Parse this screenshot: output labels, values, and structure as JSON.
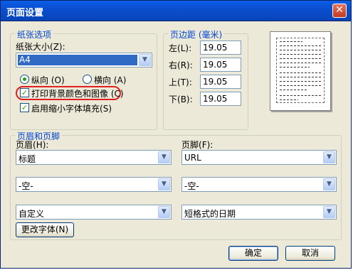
{
  "window": {
    "title": "页面设置",
    "close_label": "✕"
  },
  "paper": {
    "legend": "纸张选项",
    "size_label": "纸张大小",
    "size_key": "(Z)",
    "size_value": "A4",
    "orientation": {
      "portrait_label": "纵向",
      "portrait_key": "(O)",
      "landscape_label": "横向",
      "landscape_key": "(A)",
      "selected": "portrait"
    },
    "print_background_label": "打印背景颜色和图像",
    "print_background_key": "(C)",
    "print_background_checked": true,
    "shrink_to_fit_label": "启用缩小字体填充",
    "shrink_to_fit_key": "(S)",
    "shrink_to_fit_checked": true
  },
  "margins": {
    "legend": "页边距 (毫米)",
    "left_label": "左",
    "left_key": "(L)",
    "left_value": "19.05",
    "right_label": "右",
    "right_key": "(R)",
    "right_value": "19.05",
    "top_label": "上",
    "top_key": "(T)",
    "top_value": "19.05",
    "bottom_label": "下",
    "bottom_key": "(B)",
    "bottom_value": "19.05"
  },
  "headers_footers": {
    "legend": "页眉和页脚",
    "header_label": "页眉",
    "header_key": "(H)",
    "footer_label": "页脚",
    "footer_key": "(F)",
    "header_rows": [
      "标题",
      "-空-",
      "自定义"
    ],
    "footer_rows": [
      "URL",
      "-空-",
      "短格式的日期"
    ],
    "change_font_label": "更改字体",
    "change_font_key": "(N)"
  },
  "buttons": {
    "ok": "确定",
    "cancel": "取消"
  },
  "icons": {
    "close": "close-icon",
    "dropdown": "chevron-down-icon"
  },
  "colors": {
    "title_bar": "#0a5ee8",
    "legend_text": "#0046d5",
    "highlight": "#e02020",
    "selection": "#316ac5"
  }
}
